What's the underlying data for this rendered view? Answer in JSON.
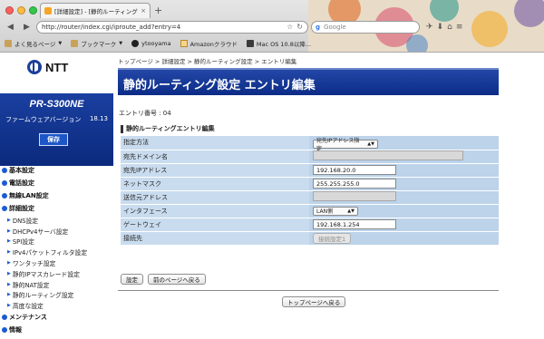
{
  "browser": {
    "tab_title": "[詳細設定] - [静的ルーティング設...",
    "tab_close": "×",
    "new_tab": "+",
    "url": "http://router/index.cgi/iproute_add?entry=4",
    "search_placeholder": "Google",
    "bookmarks": [
      {
        "label": "よく見るページ",
        "icon": "folder-icon"
      },
      {
        "label": "ブックマーク",
        "icon": "folder-icon"
      },
      {
        "label": "ytooyama",
        "icon": "github-icon"
      },
      {
        "label": "Amazonクラウド",
        "icon": "amazon-icon"
      },
      {
        "label": "Mac OS 10.8以降...",
        "icon": "mac-icon"
      }
    ]
  },
  "sidebar": {
    "logo_text": "NTT",
    "model": "PR-S300NE",
    "firmware_label": "ファームウェアバージョン",
    "firmware_version": "18.13",
    "save_label": "保存",
    "nav": {
      "basic": "基本設定",
      "phone": "電話設定",
      "wlan": "無線LAN設定",
      "advanced": "詳細設定",
      "sub": [
        "DNS設定",
        "DHCPv4サーバ設定",
        "SPI設定",
        "IPv4パケットフィルタ設定",
        "ワンタッチ設定",
        "静的IPマスカレード設定",
        "静的NAT設定",
        "静的ルーティング設定",
        "高度な設定"
      ],
      "maintenance": "メンテナンス",
      "status": "情報"
    }
  },
  "main": {
    "breadcrumb": "トップページ > 詳細設定 > 静的ルーティング設定 > エントリ編集",
    "title": "静的ルーティング設定 エントリ編集",
    "entry_number": "エントリ番号 : 04",
    "section_title": "静的ルーティングエントリ編集",
    "form": {
      "dest_method_label": "指定方法",
      "dest_method_value": "宛先IPアドレス指定",
      "dest_domain_label": "宛先ドメイン名",
      "dest_domain_value": "",
      "dest_ip_label": "宛先IPアドレス",
      "dest_ip_value": "192.168.20.0",
      "netmask_label": "ネットマスク",
      "netmask_value": "255.255.255.0",
      "src_ip_label": "送信元アドレス",
      "src_ip_value": "",
      "interface_label": "インタフェース",
      "interface_value": "LAN側",
      "gateway_label": "ゲートウェイ",
      "gateway_value": "192.168.1.254",
      "connection_label": "接続先",
      "connection_value": "接続設定1"
    },
    "set_button": "設定",
    "back_button": "前のページへ戻る",
    "top_button": "トップページへ戻る"
  }
}
